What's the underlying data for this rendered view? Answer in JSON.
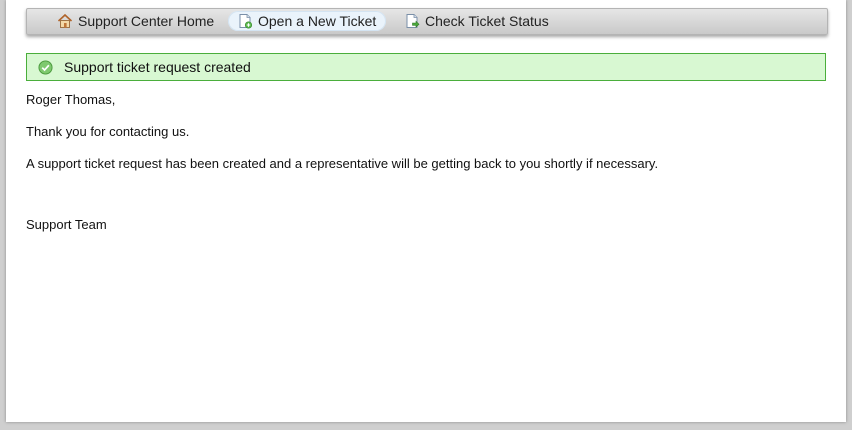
{
  "nav": {
    "items": [
      {
        "label": "Support Center Home",
        "icon": "home-icon"
      },
      {
        "label": "Open a New Ticket",
        "icon": "new-ticket-icon",
        "active": true
      },
      {
        "label": "Check Ticket Status",
        "icon": "ticket-status-icon"
      }
    ]
  },
  "alert": {
    "message": "Support ticket request created",
    "icon": "check-circle-icon",
    "color": "#4aae3b"
  },
  "content": {
    "greeting": "Roger Thomas,",
    "thanks": "Thank you for contacting us.",
    "body": "A support ticket request has been created and a representative will be getting back to you shortly if necessary.",
    "signature": "Support Team"
  }
}
